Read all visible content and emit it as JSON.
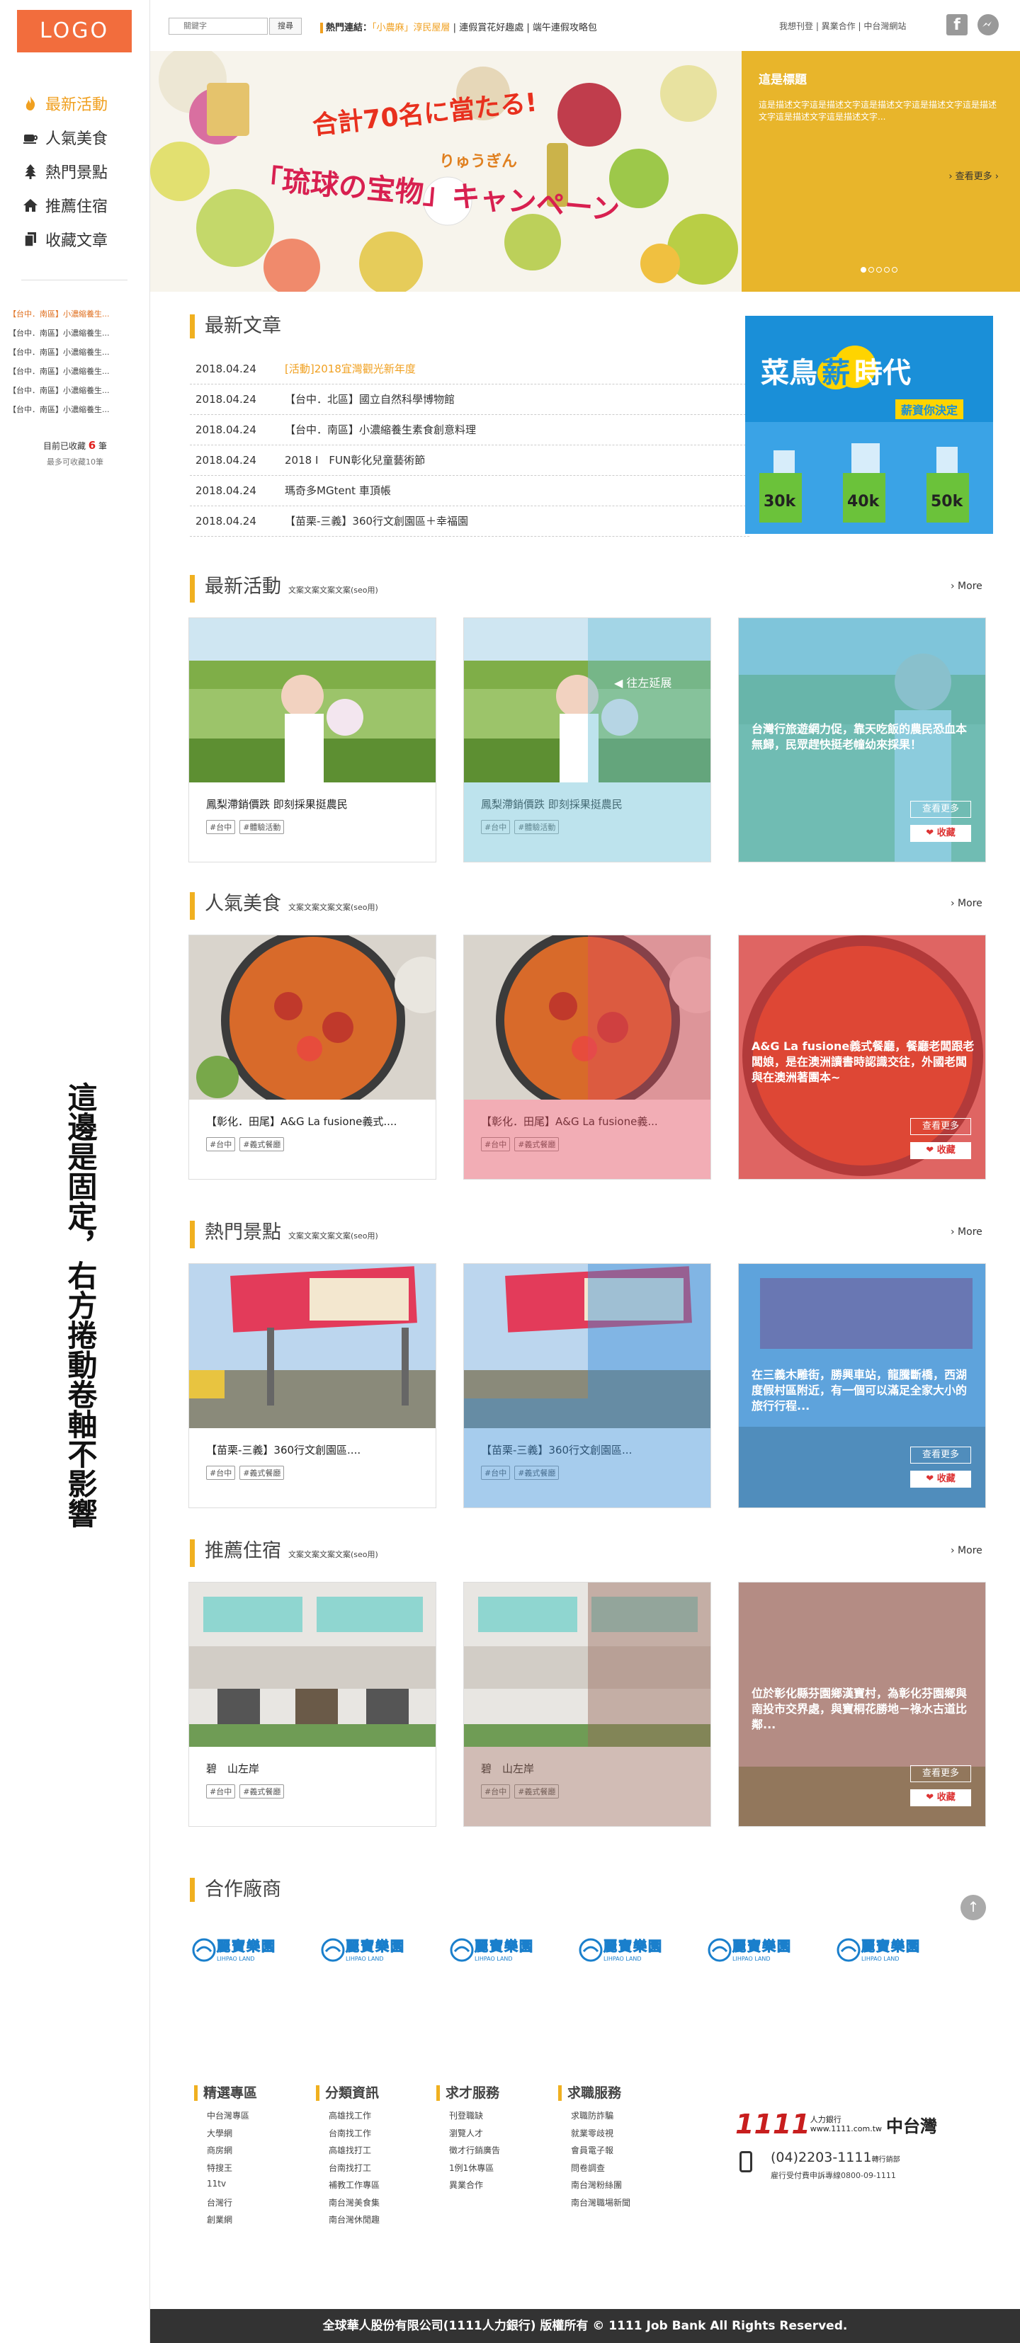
{
  "sidebar": {
    "logo": "LOGO",
    "nav": [
      {
        "label": "最新活動",
        "icon": "fire-icon",
        "active": true
      },
      {
        "label": "人氣美食",
        "icon": "food-icon"
      },
      {
        "label": "熱門景點",
        "icon": "tree-icon"
      },
      {
        "label": "推薦住宿",
        "icon": "house-icon"
      },
      {
        "label": "收藏文章",
        "icon": "copy-icon"
      }
    ],
    "favorites": [
      "【台中．南區】小濃縮養生...",
      "【台中．南區】小濃縮養生...",
      "【台中．南區】小濃縮養生...",
      "【台中．南區】小濃縮養生...",
      "【台中．南區】小濃縮養生...",
      "【台中．南區】小濃縮養生..."
    ],
    "fav_count_pre": "目前已收藏",
    "fav_count": "6",
    "fav_count_post": "筆",
    "fav_limit": "最多可收藏10筆",
    "vertical_note": "這邊是固定，右方捲動卷軸不影響"
  },
  "topbar": {
    "search_placeholder": "關鍵字",
    "search_button": "搜尋",
    "hot_label": "熱門連結：",
    "hot_link1": "「小農麻」淳民屋層",
    "hot_sep": " | ",
    "hot_link2": "連假賞花好趣處",
    "hot_link3": "端午連假攻略包",
    "links": "我想刊登 | 異業合作 | 中台灣網站",
    "fb": "f"
  },
  "banner": {
    "text1": "合計70名に當たる!",
    "text2": "りゅうぎん",
    "text3": "「琉球の宝物」キャンペーン",
    "side_title": "這是標題",
    "side_desc": "這是描述文字這是描述文字這是描述文字這是描述文字這是描述文字這是描述文字這是描述文字...",
    "side_more": "› 查看更多 ›",
    "dots": 5,
    "active_dot": 0
  },
  "news": {
    "heading": "最新文章",
    "rows": [
      {
        "date": "2018.04.24",
        "title": "[活動]2018宜灣觀光新年度",
        "hl": true
      },
      {
        "date": "2018.04.24",
        "title": "【台中．北區】國立自然科學博物館"
      },
      {
        "date": "2018.04.24",
        "title": "【台中．南區】小濃縮養生素食創意料理"
      },
      {
        "date": "2018.04.24",
        "title": "2018 I　FUN彰化兒童藝術節"
      },
      {
        "date": "2018.04.24",
        "title": "瑪奇多MGtent 車頂帳"
      },
      {
        "date": "2018.04.24",
        "title": "【苗栗-三義】360行文創園區＋幸福園"
      }
    ]
  },
  "ad": {
    "title_a": "菜鳥",
    "title_b": "薪",
    "title_c": "時代",
    "sub": "薪資你決定",
    "bars": [
      "30k",
      "40k",
      "50k"
    ]
  },
  "sections": [
    {
      "heading": "最新活動",
      "sub": "文案文案文案文案(seo用)",
      "more": "› More",
      "card_title": "鳳梨滯銷價跌 即刻採果挺農民",
      "card_title2": "鳳梨滯銷價跌 即刻採果挺農民",
      "tags": [
        "#台中",
        "#體驗活動"
      ],
      "hover": "往左延展",
      "desc": "台灣行旅遊網力促，靠天吃飯的農民恐血本無歸，民眾趕快挺老幢幼來採果！",
      "btn_more": "查看更多",
      "btn_fav": "❤ 收藏"
    },
    {
      "heading": "人氣美食",
      "sub": "文案文案文案文案(seo用)",
      "more": "› More",
      "card_title": "【彰化．田尾】A&G La fusione義式....",
      "card_title2": "【彰化．田尾】A&G La fusione義...",
      "tags": [
        "#台中",
        "#義式餐廳"
      ],
      "desc": "A&G La fusione義式餐廳，餐廳老闆跟老闆娘，是在澳洲讀書時認識交往，外國老闆與在澳洲著團本~",
      "btn_more": "查看更多",
      "btn_fav": "❤ 收藏"
    },
    {
      "heading": "熱門景點",
      "sub": "文案文案文案文案(seo用)",
      "more": "› More",
      "card_title": "【苗栗-三義】360行文創園區....",
      "card_title2": "【苗栗-三義】360行文創園區...",
      "tags": [
        "#台中",
        "#義式餐廳"
      ],
      "desc": "在三義木雕街，勝興車站，龍騰斷橋，西湖度假村區附近，有一個可以滿足全家大小的旅行行程...",
      "btn_more": "查看更多",
      "btn_fav": "❤ 收藏"
    },
    {
      "heading": "推薦住宿",
      "sub": "文案文案文案文案(seo用)",
      "more": "› More",
      "card_title": "碧　山左岸",
      "card_title2": "碧　山左岸",
      "tags": [
        "#台中",
        "#義式餐廳"
      ],
      "desc": "位於彰化縣芬園鄉漢寶村，為彰化芬園鄉與南投市交界處，與寶桐花勝地－祿水古道比鄰...",
      "btn_more": "查看更多",
      "btn_fav": "❤ 收藏"
    }
  ],
  "partners": {
    "heading": "合作廠商",
    "logo_text": "麗寶樂園",
    "logo_sub": "LIHPAO LAND",
    "count": 6
  },
  "footer_cols": [
    {
      "title": "精選專區",
      "items": [
        "中台灣專區",
        "大學網",
        "商房網",
        "特搜王",
        "11tv",
        "台灣行",
        "創業網"
      ]
    },
    {
      "title": "分類資訊",
      "items": [
        "高雄找工作",
        "台南找工作",
        "高雄找打工",
        "台南找打工",
        "補教工作專區",
        "南台灣美食集",
        "南台灣休閒趣"
      ]
    },
    {
      "title": "求才服務",
      "items": [
        "刊登職缺",
        "瀏覽人才",
        "徵才行銷廣告",
        "1例1休專區",
        "異業合作"
      ]
    },
    {
      "title": "求職服務",
      "items": [
        "求職防詐騙",
        "就業零歧視",
        "會員電子報",
        "問卷調查",
        "南台灣粉絲團",
        "南台灣職場新聞"
      ]
    }
  ],
  "brand": {
    "num": "1111",
    "name1": "人力銀行",
    "name2": "www.1111.com.tw",
    "region": "中台灣",
    "phone": "(04)2203-1111",
    "phone_suffix": "轉行銷部",
    "phone2": "雇行受付費申訴專線0800-09-1111"
  },
  "footer": "全球華人股份有限公司(1111人力銀行) 版權所有 © 1111 Job Bank All Rights Reserved.",
  "colors": {
    "accent": "#f0b020",
    "logo": "#f26d3d",
    "banner_side": "#e8b52b",
    "ad": "#1a8fd8",
    "footer": "#333333"
  }
}
